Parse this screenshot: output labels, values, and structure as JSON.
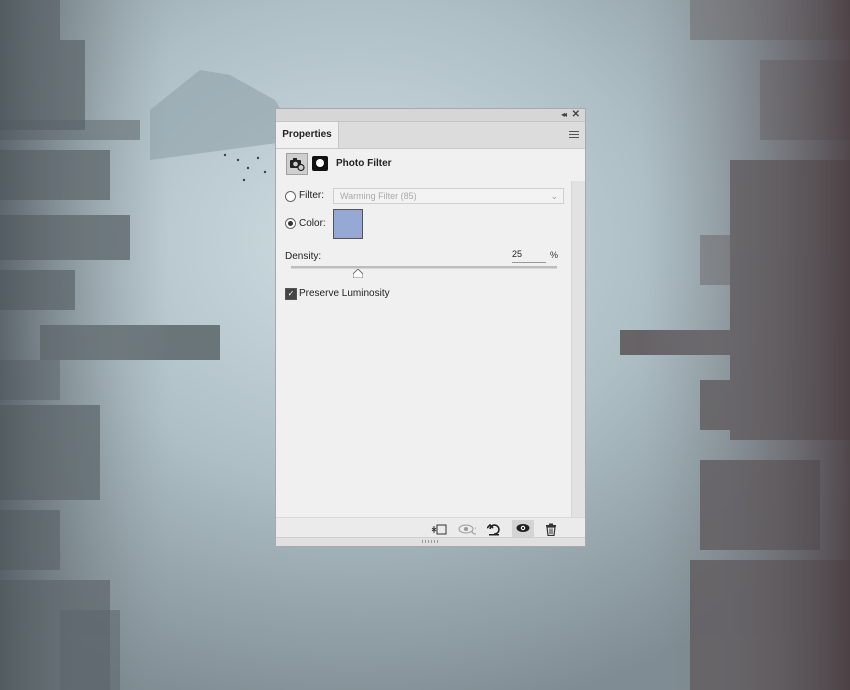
{
  "panel": {
    "tab_label": "Properties",
    "adjustment_title": "Photo Filter",
    "filter": {
      "label": "Filter:",
      "selected": false,
      "value": "Warming Filter (85)"
    },
    "color": {
      "label": "Color:",
      "selected": true,
      "swatch": "#96a9d5"
    },
    "density": {
      "label": "Density:",
      "value": "25",
      "unit": "%",
      "fraction": 0.25
    },
    "preserve_luminosity": {
      "label": "Preserve Luminosity",
      "checked": true
    },
    "footer_icons": [
      "clip-to-layer-icon",
      "view-previous-state-icon",
      "reset-icon",
      "visibility-eye-icon",
      "trash-icon"
    ]
  },
  "colors": {
    "panel_bg": "#f0f0f0",
    "accent_swatch": "#96a9d5"
  }
}
